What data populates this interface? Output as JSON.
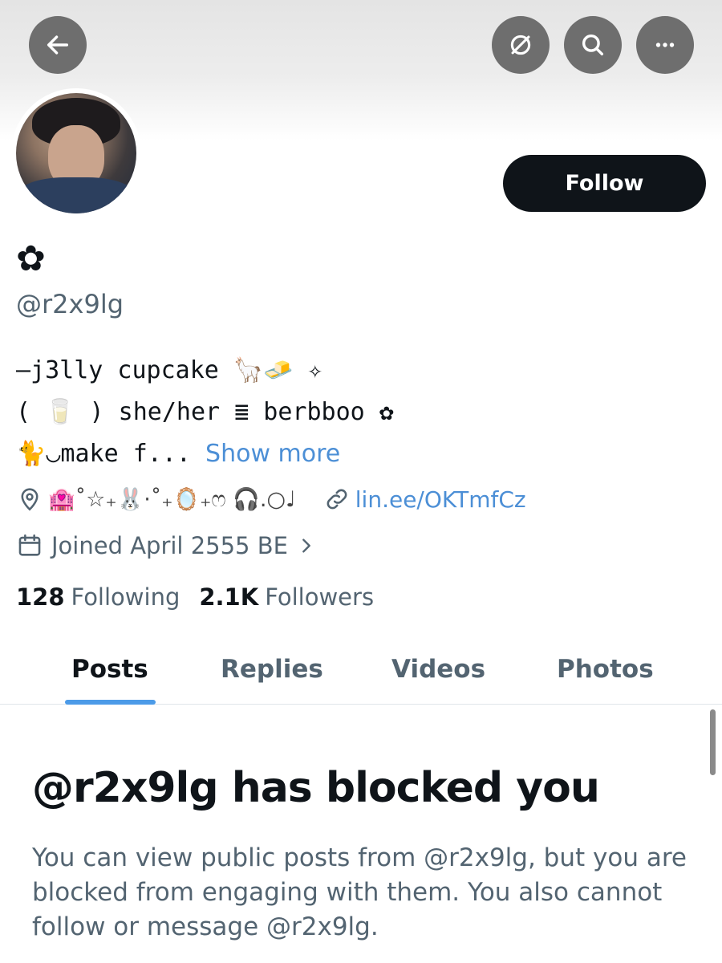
{
  "header": {
    "back_icon": "arrow-left-icon",
    "hide_icon": "eye-slash-icon",
    "search_icon": "search-icon",
    "more_icon": "ellipsis-icon"
  },
  "profile": {
    "display_name": "✿",
    "handle": "@r2x9lg",
    "follow_label": "Follow",
    "bio": {
      "line1": "—j3lly cupcake 🦙🧈 ✧",
      "line2": "( 🥛 ) she/her ≣ berbboo ✿",
      "line3": "🐈◡make f...",
      "show_more": "Show more"
    },
    "location": "🏩˚☆₊🐰·˚₊🪞₊ෆ 🎧.○♩",
    "link": "lin.ee/OKTmfCz",
    "joined": "Joined April 2555 BE",
    "following_count": "128",
    "following_label": "Following",
    "followers_count": "2.1K",
    "followers_label": "Followers"
  },
  "tabs": [
    {
      "label": "Posts",
      "active": true
    },
    {
      "label": "Replies",
      "active": false
    },
    {
      "label": "Videos",
      "active": false
    },
    {
      "label": "Photos",
      "active": false
    }
  ],
  "blocked": {
    "title": "@r2x9lg has blocked you",
    "body": "You can view public posts from @r2x9lg, but you are blocked from engaging with them. You also cannot follow or message @r2x9lg."
  },
  "colors": {
    "accent": "#1d9bf0",
    "link": "#4c8fd6",
    "text_primary": "#0f1419",
    "text_secondary": "#536471"
  }
}
